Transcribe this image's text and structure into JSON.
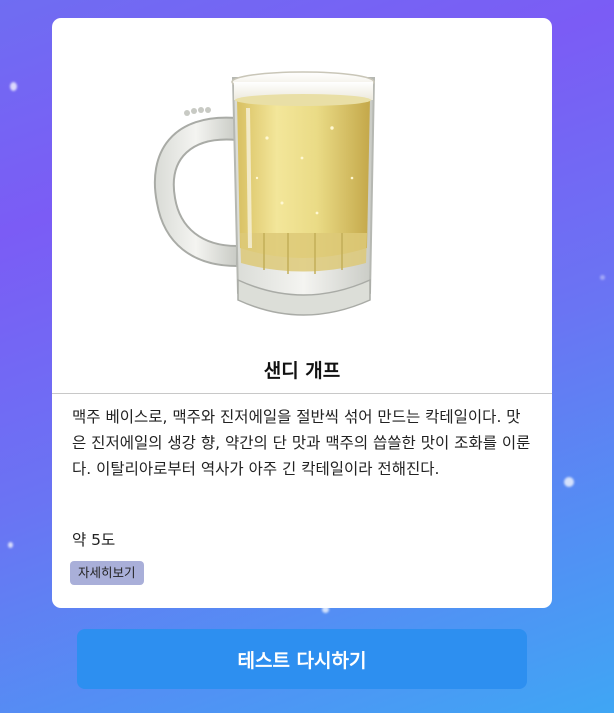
{
  "result": {
    "drink_name": "샌디 개프",
    "image_subject": "beer-mug-image",
    "description": "맥주 베이스로, 맥주와 진저에일을 절반씩 섞어 만드는 칵테일이다. 맛은 진저에일의 생강 향, 약간의 단 맛과 맥주의 씁쓸한 맛이 조화를 이룬다. 이탈리아로부터 역사가 아주 긴 칵테일이라 전해진다.",
    "abv": "약 5도",
    "detail_button_label": "자세히보기"
  },
  "retry_button_label": "테스트 다시하기",
  "colors": {
    "background_top": "#7b5cf5",
    "background_bottom": "#3fa6f4",
    "retry_button": "#2d8ff0",
    "detail_button": "#a9afd9"
  }
}
